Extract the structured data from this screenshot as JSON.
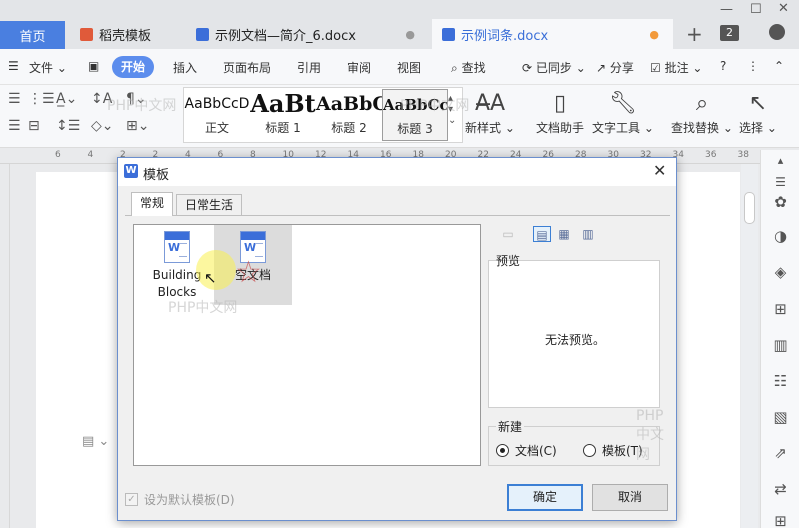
{
  "tabs": {
    "home": "首页",
    "tab1": "稻壳模板",
    "tab2": "示例文档—简介_6.docx",
    "tab3": "示例词条.docx",
    "counter": "2"
  },
  "menu": {
    "file": "文件",
    "start": "开始",
    "insert": "插入",
    "layout": "页面布局",
    "reference": "引用",
    "review": "审阅",
    "view": "视图",
    "find": "查找",
    "sync": "已同步",
    "share": "分享",
    "annotate": "批注"
  },
  "ribbon": {
    "styles": [
      {
        "preview": "AaBbCcD",
        "label": "正文"
      },
      {
        "preview": "AaBt",
        "label": "标题 1"
      },
      {
        "preview": "AaBbC",
        "label": "标题 2"
      },
      {
        "preview": "AaBbCcI",
        "label": "标题 3"
      }
    ],
    "new_style": "新样式",
    "doc_assistant": "文档助手",
    "text_tools": "文字工具",
    "find_replace": "查找替换",
    "select": "选择"
  },
  "ruler": [
    "6",
    "4",
    "2",
    "2",
    "4",
    "6",
    "8",
    "10",
    "12",
    "14",
    "16",
    "18",
    "20",
    "22",
    "24",
    "26",
    "28",
    "30",
    "32",
    "34",
    "36",
    "38",
    "40"
  ],
  "dialog": {
    "title": "模板",
    "tabs": [
      "常规",
      "日常生活"
    ],
    "templates": [
      {
        "name_line1": "Building",
        "name_line2": "Blocks"
      },
      {
        "name_line1": "空文档",
        "name_line2": ""
      }
    ],
    "preview_label": "预览",
    "preview_message": "无法预览。",
    "new_label": "新建",
    "radio_doc": "文档(C)",
    "radio_tpl": "模板(T)",
    "default_checkbox": "设为默认模板(D)",
    "ok": "确定",
    "cancel": "取消"
  },
  "watermark": "PHP中文网"
}
